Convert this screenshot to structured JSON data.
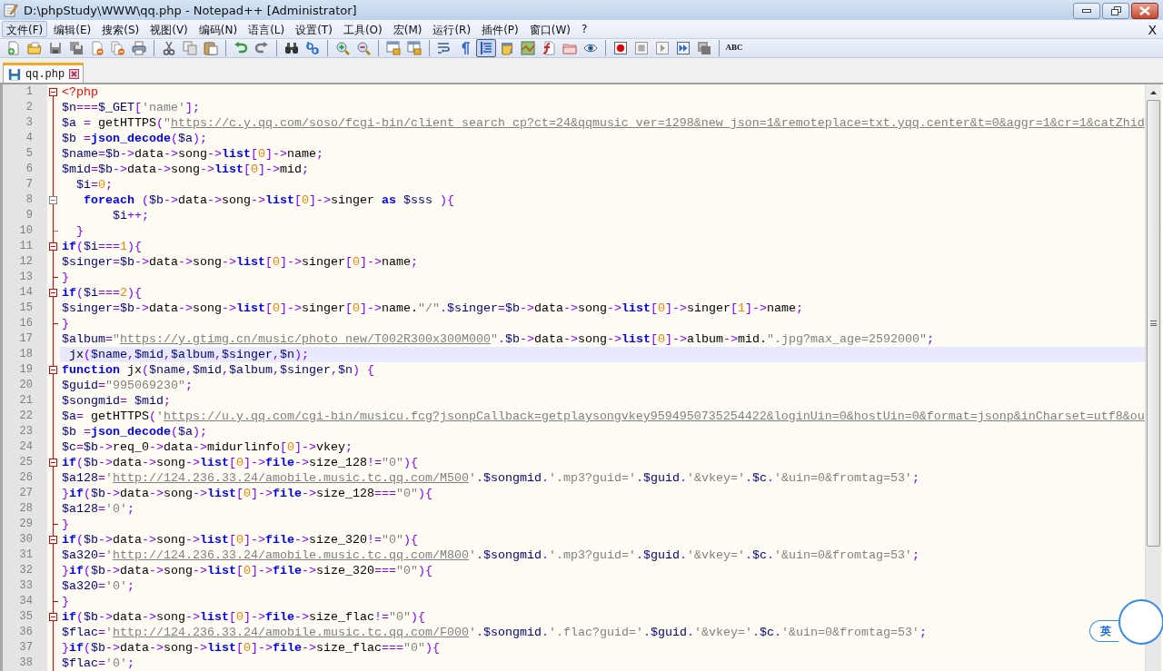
{
  "window": {
    "title": "D:\\phpStudy\\WWW\\qq.php - Notepad++ [Administrator]"
  },
  "menu": {
    "items": [
      {
        "label": "文件(F)",
        "selected": true
      },
      {
        "label": "编辑(E)",
        "selected": false
      },
      {
        "label": "搜索(S)",
        "selected": false
      },
      {
        "label": "视图(V)",
        "selected": false
      },
      {
        "label": "编码(N)",
        "selected": false
      },
      {
        "label": "语言(L)",
        "selected": false
      },
      {
        "label": "设置(T)",
        "selected": false
      },
      {
        "label": "工具(O)",
        "selected": false
      },
      {
        "label": "宏(M)",
        "selected": false
      },
      {
        "label": "运行(R)",
        "selected": false
      },
      {
        "label": "插件(P)",
        "selected": false
      },
      {
        "label": "窗口(W)",
        "selected": false
      },
      {
        "label": "?",
        "selected": false
      }
    ],
    "close_document": "X"
  },
  "toolbar": {
    "groups": [
      [
        {
          "kind": "new",
          "pressed": false
        },
        {
          "kind": "open",
          "pressed": false
        },
        {
          "kind": "save",
          "pressed": false
        },
        {
          "kind": "saveall",
          "pressed": false
        },
        {
          "kind": "close",
          "pressed": false
        },
        {
          "kind": "closeall",
          "pressed": false
        },
        {
          "kind": "print",
          "pressed": false
        }
      ],
      [
        {
          "kind": "cut",
          "pressed": false
        },
        {
          "kind": "copy",
          "pressed": false
        },
        {
          "kind": "paste",
          "pressed": false
        }
      ],
      [
        {
          "kind": "undo",
          "pressed": false
        },
        {
          "kind": "redo",
          "pressed": false
        }
      ],
      [
        {
          "kind": "find",
          "pressed": false
        },
        {
          "kind": "replace",
          "pressed": false
        }
      ],
      [
        {
          "kind": "zoomin",
          "pressed": false
        },
        {
          "kind": "zoomout",
          "pressed": false
        }
      ],
      [
        {
          "kind": "syncv",
          "pressed": false
        },
        {
          "kind": "synch",
          "pressed": false
        }
      ],
      [
        {
          "kind": "wrap",
          "pressed": false
        },
        {
          "kind": "allchars",
          "pressed": false
        },
        {
          "kind": "indent",
          "pressed": true
        },
        {
          "kind": "udl",
          "pressed": false
        },
        {
          "kind": "docmap",
          "pressed": false
        },
        {
          "kind": "funclist",
          "pressed": false
        },
        {
          "kind": "folder",
          "pressed": false
        },
        {
          "kind": "monitor",
          "pressed": false
        }
      ],
      [
        {
          "kind": "record",
          "pressed": false
        },
        {
          "kind": "stop",
          "pressed": false
        },
        {
          "kind": "play",
          "pressed": false
        },
        {
          "kind": "playmulti",
          "pressed": false
        },
        {
          "kind": "savemacro",
          "pressed": false
        }
      ],
      [
        {
          "kind": "spellcheck",
          "pressed": false,
          "label": "ABC"
        }
      ]
    ]
  },
  "tabs": [
    {
      "label": "qq.php",
      "selected": true
    }
  ],
  "editor": {
    "lines": [
      {
        "number": "1",
        "fold": {
          "kind": "start"
        },
        "current": false,
        "tokens": [
          {
            "kind": "tag",
            "text": "<?php"
          }
        ]
      },
      {
        "number": "2",
        "current": false,
        "tokens": [
          {
            "kind": "var",
            "text": "$n"
          },
          {
            "kind": "op",
            "text": "==="
          },
          {
            "kind": "var",
            "text": "$_GET"
          },
          {
            "kind": "op",
            "text": "["
          },
          {
            "kind": "str",
            "text": "'name'"
          },
          {
            "kind": "op",
            "text": "];"
          }
        ]
      },
      {
        "number": "3",
        "current": false,
        "tokens": [
          {
            "kind": "var",
            "text": "$a"
          },
          {
            "kind": "op",
            "text": " ="
          },
          {
            "kind": "plain",
            "text": " getHTTPS"
          },
          {
            "kind": "op",
            "text": "("
          },
          {
            "kind": "str",
            "text": "\""
          },
          {
            "kind": "url",
            "text": "https://c.y.qq.com/soso/fcgi-bin/client_search_cp?ct=24&qqmusic_ver=1298&new_json=1&remoteplace=txt.yqq.center&t=0&aggr=1&cr=1&catZhid"
          }
        ]
      },
      {
        "number": "4",
        "current": false,
        "tokens": [
          {
            "kind": "var",
            "text": "$b"
          },
          {
            "kind": "op",
            "text": " ="
          },
          {
            "kind": "kw",
            "text": "json_decode"
          },
          {
            "kind": "op",
            "text": "("
          },
          {
            "kind": "var",
            "text": "$a"
          },
          {
            "kind": "op",
            "text": ");"
          }
        ]
      },
      {
        "number": "5",
        "current": false,
        "tokens": [
          {
            "kind": "var",
            "text": "$name"
          },
          {
            "kind": "op",
            "text": "="
          },
          {
            "kind": "var",
            "text": "$b"
          },
          {
            "kind": "op",
            "text": "->"
          },
          {
            "kind": "plain",
            "text": "data"
          },
          {
            "kind": "op",
            "text": "->"
          },
          {
            "kind": "plain",
            "text": "song"
          },
          {
            "kind": "op",
            "text": "->"
          },
          {
            "kind": "kw",
            "text": "list"
          },
          {
            "kind": "op",
            "text": "["
          },
          {
            "kind": "num",
            "text": "0"
          },
          {
            "kind": "op",
            "text": "]->"
          },
          {
            "kind": "plain",
            "text": "name"
          },
          {
            "kind": "op",
            "text": ";"
          }
        ]
      },
      {
        "number": "6",
        "current": false,
        "tokens": [
          {
            "kind": "var",
            "text": "$mid"
          },
          {
            "kind": "op",
            "text": "="
          },
          {
            "kind": "var",
            "text": "$b"
          },
          {
            "kind": "op",
            "text": "->"
          },
          {
            "kind": "plain",
            "text": "data"
          },
          {
            "kind": "op",
            "text": "->"
          },
          {
            "kind": "plain",
            "text": "song"
          },
          {
            "kind": "op",
            "text": "->"
          },
          {
            "kind": "kw",
            "text": "list"
          },
          {
            "kind": "op",
            "text": "["
          },
          {
            "kind": "num",
            "text": "0"
          },
          {
            "kind": "op",
            "text": "]->"
          },
          {
            "kind": "plain",
            "text": "mid"
          },
          {
            "kind": "op",
            "text": ";"
          }
        ]
      },
      {
        "number": "7",
        "current": false,
        "tokens": [
          {
            "kind": "var",
            "text": "  $i"
          },
          {
            "kind": "op",
            "text": "="
          },
          {
            "kind": "num",
            "text": "0"
          },
          {
            "kind": "op",
            "text": ";"
          }
        ]
      },
      {
        "number": "8",
        "fold": {
          "kind": "inner-start"
        },
        "current": false,
        "tokens": [
          {
            "kind": "kw",
            "text": "   foreach"
          },
          {
            "kind": "op",
            "text": " ("
          },
          {
            "kind": "var",
            "text": "$b"
          },
          {
            "kind": "op",
            "text": "->"
          },
          {
            "kind": "plain",
            "text": "data"
          },
          {
            "kind": "op",
            "text": "->"
          },
          {
            "kind": "plain",
            "text": "song"
          },
          {
            "kind": "op",
            "text": "->"
          },
          {
            "kind": "kw",
            "text": "list"
          },
          {
            "kind": "op",
            "text": "["
          },
          {
            "kind": "num",
            "text": "0"
          },
          {
            "kind": "op",
            "text": "]->"
          },
          {
            "kind": "plain",
            "text": "singer "
          },
          {
            "kind": "kw",
            "text": "as"
          },
          {
            "kind": "var",
            "text": " $sss"
          },
          {
            "kind": "op",
            "text": " ){"
          }
        ]
      },
      {
        "number": "9",
        "current": false,
        "tokens": [
          {
            "kind": "var",
            "text": "       $i"
          },
          {
            "kind": "op",
            "text": "++;"
          }
        ]
      },
      {
        "number": "10",
        "fold": {
          "kind": "inner-end"
        },
        "current": false,
        "tokens": [
          {
            "kind": "op",
            "text": "  }"
          }
        ]
      },
      {
        "number": "11",
        "fold": {
          "kind": "start"
        },
        "current": false,
        "tokens": [
          {
            "kind": "kw",
            "text": "if"
          },
          {
            "kind": "op",
            "text": "("
          },
          {
            "kind": "var",
            "text": "$i"
          },
          {
            "kind": "op",
            "text": "==="
          },
          {
            "kind": "num",
            "text": "1"
          },
          {
            "kind": "op",
            "text": "){"
          }
        ]
      },
      {
        "number": "12",
        "current": false,
        "tokens": [
          {
            "kind": "var",
            "text": "$singer"
          },
          {
            "kind": "op",
            "text": "="
          },
          {
            "kind": "var",
            "text": "$b"
          },
          {
            "kind": "op",
            "text": "->"
          },
          {
            "kind": "plain",
            "text": "data"
          },
          {
            "kind": "op",
            "text": "->"
          },
          {
            "kind": "plain",
            "text": "song"
          },
          {
            "kind": "op",
            "text": "->"
          },
          {
            "kind": "kw",
            "text": "list"
          },
          {
            "kind": "op",
            "text": "["
          },
          {
            "kind": "num",
            "text": "0"
          },
          {
            "kind": "op",
            "text": "]->"
          },
          {
            "kind": "plain",
            "text": "singer"
          },
          {
            "kind": "op",
            "text": "["
          },
          {
            "kind": "num",
            "text": "0"
          },
          {
            "kind": "op",
            "text": "]->"
          },
          {
            "kind": "plain",
            "text": "name"
          },
          {
            "kind": "op",
            "text": ";"
          }
        ]
      },
      {
        "number": "13",
        "fold": {
          "kind": "end"
        },
        "current": false,
        "tokens": [
          {
            "kind": "op",
            "text": "}"
          }
        ]
      },
      {
        "number": "14",
        "fold": {
          "kind": "start"
        },
        "current": false,
        "tokens": [
          {
            "kind": "kw",
            "text": "if"
          },
          {
            "kind": "op",
            "text": "("
          },
          {
            "kind": "var",
            "text": "$i"
          },
          {
            "kind": "op",
            "text": "==="
          },
          {
            "kind": "num",
            "text": "2"
          },
          {
            "kind": "op",
            "text": "){"
          }
        ]
      },
      {
        "number": "15",
        "current": false,
        "tokens": [
          {
            "kind": "var",
            "text": "$singer"
          },
          {
            "kind": "op",
            "text": "="
          },
          {
            "kind": "var",
            "text": "$b"
          },
          {
            "kind": "op",
            "text": "->"
          },
          {
            "kind": "plain",
            "text": "data"
          },
          {
            "kind": "op",
            "text": "->"
          },
          {
            "kind": "plain",
            "text": "song"
          },
          {
            "kind": "op",
            "text": "->"
          },
          {
            "kind": "kw",
            "text": "list"
          },
          {
            "kind": "op",
            "text": "["
          },
          {
            "kind": "num",
            "text": "0"
          },
          {
            "kind": "op",
            "text": "]->"
          },
          {
            "kind": "plain",
            "text": "singer"
          },
          {
            "kind": "op",
            "text": "["
          },
          {
            "kind": "num",
            "text": "0"
          },
          {
            "kind": "op",
            "text": "]->"
          },
          {
            "kind": "plain",
            "text": "name."
          },
          {
            "kind": "str",
            "text": "\"/\""
          },
          {
            "kind": "op",
            "text": "."
          },
          {
            "kind": "var",
            "text": "$singer"
          },
          {
            "kind": "op",
            "text": "="
          },
          {
            "kind": "var",
            "text": "$b"
          },
          {
            "kind": "op",
            "text": "->"
          },
          {
            "kind": "plain",
            "text": "data"
          },
          {
            "kind": "op",
            "text": "->"
          },
          {
            "kind": "plain",
            "text": "song"
          },
          {
            "kind": "op",
            "text": "->"
          },
          {
            "kind": "kw",
            "text": "list"
          },
          {
            "kind": "op",
            "text": "["
          },
          {
            "kind": "num",
            "text": "0"
          },
          {
            "kind": "op",
            "text": "]->"
          },
          {
            "kind": "plain",
            "text": "singer"
          },
          {
            "kind": "op",
            "text": "["
          },
          {
            "kind": "num",
            "text": "1"
          },
          {
            "kind": "op",
            "text": "]->"
          },
          {
            "kind": "plain",
            "text": "name"
          },
          {
            "kind": "op",
            "text": ";"
          }
        ]
      },
      {
        "number": "16",
        "fold": {
          "kind": "end"
        },
        "current": false,
        "tokens": [
          {
            "kind": "op",
            "text": "}"
          }
        ]
      },
      {
        "number": "17",
        "current": false,
        "tokens": [
          {
            "kind": "var",
            "text": "$album"
          },
          {
            "kind": "op",
            "text": "="
          },
          {
            "kind": "str",
            "text": "\""
          },
          {
            "kind": "url",
            "text": "https://y.gtimg.cn/music/photo_new/T002R300x300M000"
          },
          {
            "kind": "str",
            "text": "\""
          },
          {
            "kind": "op",
            "text": "."
          },
          {
            "kind": "var",
            "text": "$b"
          },
          {
            "kind": "op",
            "text": "->"
          },
          {
            "kind": "plain",
            "text": "data"
          },
          {
            "kind": "op",
            "text": "->"
          },
          {
            "kind": "plain",
            "text": "song"
          },
          {
            "kind": "op",
            "text": "->"
          },
          {
            "kind": "kw",
            "text": "list"
          },
          {
            "kind": "op",
            "text": "["
          },
          {
            "kind": "num",
            "text": "0"
          },
          {
            "kind": "op",
            "text": "]->"
          },
          {
            "kind": "plain",
            "text": "album"
          },
          {
            "kind": "op",
            "text": "->"
          },
          {
            "kind": "plain",
            "text": "mid."
          },
          {
            "kind": "str",
            "text": "\".jpg?max_age=2592000\""
          },
          {
            "kind": "op",
            "text": ";"
          }
        ]
      },
      {
        "number": "18",
        "current": true,
        "tokens": [
          {
            "kind": "plain",
            "text": " jx"
          },
          {
            "kind": "op",
            "text": "("
          },
          {
            "kind": "var",
            "text": "$name"
          },
          {
            "kind": "op",
            "text": ","
          },
          {
            "kind": "var",
            "text": "$mid"
          },
          {
            "kind": "op",
            "text": ","
          },
          {
            "kind": "var",
            "text": "$album"
          },
          {
            "kind": "op",
            "text": ","
          },
          {
            "kind": "var",
            "text": "$singer"
          },
          {
            "kind": "op",
            "text": ","
          },
          {
            "kind": "var",
            "text": "$n"
          },
          {
            "kind": "op",
            "text": ");"
          }
        ]
      },
      {
        "number": "19",
        "fold": {
          "kind": "start"
        },
        "current": false,
        "tokens": [
          {
            "kind": "kw",
            "text": "function"
          },
          {
            "kind": "plain",
            "text": " jx"
          },
          {
            "kind": "op",
            "text": "("
          },
          {
            "kind": "var",
            "text": "$name"
          },
          {
            "kind": "op",
            "text": ","
          },
          {
            "kind": "var",
            "text": "$mid"
          },
          {
            "kind": "op",
            "text": ","
          },
          {
            "kind": "var",
            "text": "$album"
          },
          {
            "kind": "op",
            "text": ","
          },
          {
            "kind": "var",
            "text": "$singer"
          },
          {
            "kind": "op",
            "text": ","
          },
          {
            "kind": "var",
            "text": "$n"
          },
          {
            "kind": "op",
            "text": ") {"
          }
        ]
      },
      {
        "number": "20",
        "current": false,
        "tokens": [
          {
            "kind": "var",
            "text": "$guid"
          },
          {
            "kind": "op",
            "text": "="
          },
          {
            "kind": "str",
            "text": "\"995069230\""
          },
          {
            "kind": "op",
            "text": ";"
          }
        ]
      },
      {
        "number": "21",
        "current": false,
        "tokens": [
          {
            "kind": "var",
            "text": "$songmid"
          },
          {
            "kind": "op",
            "text": "="
          },
          {
            "kind": "var",
            "text": " $mid"
          },
          {
            "kind": "op",
            "text": ";"
          }
        ]
      },
      {
        "number": "22",
        "current": false,
        "tokens": [
          {
            "kind": "var",
            "text": "$a"
          },
          {
            "kind": "op",
            "text": "="
          },
          {
            "kind": "plain",
            "text": " getHTTPS"
          },
          {
            "kind": "op",
            "text": "("
          },
          {
            "kind": "str",
            "text": "'"
          },
          {
            "kind": "url",
            "text": "https://u.y.qq.com/cgi-bin/musicu.fcg?jsonpCallback=getplaysongvkey9594950735254422&loginUin=0&hostUin=0&format=jsonp&inCharset=utf8&ou"
          }
        ]
      },
      {
        "number": "23",
        "current": false,
        "tokens": [
          {
            "kind": "var",
            "text": "$b"
          },
          {
            "kind": "op",
            "text": " ="
          },
          {
            "kind": "kw",
            "text": "json_decode"
          },
          {
            "kind": "op",
            "text": "("
          },
          {
            "kind": "var",
            "text": "$a"
          },
          {
            "kind": "op",
            "text": ");"
          }
        ]
      },
      {
        "number": "24",
        "current": false,
        "tokens": [
          {
            "kind": "var",
            "text": "$c"
          },
          {
            "kind": "op",
            "text": "="
          },
          {
            "kind": "var",
            "text": "$b"
          },
          {
            "kind": "op",
            "text": "->"
          },
          {
            "kind": "plain",
            "text": "req_0"
          },
          {
            "kind": "op",
            "text": "->"
          },
          {
            "kind": "plain",
            "text": "data"
          },
          {
            "kind": "op",
            "text": "->"
          },
          {
            "kind": "plain",
            "text": "midurlinfo"
          },
          {
            "kind": "op",
            "text": "["
          },
          {
            "kind": "num",
            "text": "0"
          },
          {
            "kind": "op",
            "text": "]->"
          },
          {
            "kind": "plain",
            "text": "vkey"
          },
          {
            "kind": "op",
            "text": ";"
          }
        ]
      },
      {
        "number": "25",
        "fold": {
          "kind": "start"
        },
        "current": false,
        "tokens": [
          {
            "kind": "kw",
            "text": "if"
          },
          {
            "kind": "op",
            "text": "("
          },
          {
            "kind": "var",
            "text": "$b"
          },
          {
            "kind": "op",
            "text": "->"
          },
          {
            "kind": "plain",
            "text": "data"
          },
          {
            "kind": "op",
            "text": "->"
          },
          {
            "kind": "plain",
            "text": "song"
          },
          {
            "kind": "op",
            "text": "->"
          },
          {
            "kind": "kw",
            "text": "list"
          },
          {
            "kind": "op",
            "text": "["
          },
          {
            "kind": "num",
            "text": "0"
          },
          {
            "kind": "op",
            "text": "]->"
          },
          {
            "kind": "kw",
            "text": "file"
          },
          {
            "kind": "op",
            "text": "->"
          },
          {
            "kind": "plain",
            "text": "size_128"
          },
          {
            "kind": "op",
            "text": "!="
          },
          {
            "kind": "str",
            "text": "\"0\""
          },
          {
            "kind": "op",
            "text": "){"
          }
        ]
      },
      {
        "number": "26",
        "current": false,
        "tokens": [
          {
            "kind": "var",
            "text": "$a128"
          },
          {
            "kind": "op",
            "text": "="
          },
          {
            "kind": "str",
            "text": "'"
          },
          {
            "kind": "url",
            "text": "http://124.236.33.24/amobile.music.tc.qq.com/M500"
          },
          {
            "kind": "str",
            "text": "'"
          },
          {
            "kind": "op",
            "text": "."
          },
          {
            "kind": "var",
            "text": "$songmid"
          },
          {
            "kind": "op",
            "text": "."
          },
          {
            "kind": "str",
            "text": "'.mp3?guid='"
          },
          {
            "kind": "op",
            "text": "."
          },
          {
            "kind": "var",
            "text": "$guid"
          },
          {
            "kind": "op",
            "text": "."
          },
          {
            "kind": "str",
            "text": "'&vkey='"
          },
          {
            "kind": "op",
            "text": "."
          },
          {
            "kind": "var",
            "text": "$c"
          },
          {
            "kind": "op",
            "text": "."
          },
          {
            "kind": "str",
            "text": "'&uin=0&fromtag=53'"
          },
          {
            "kind": "op",
            "text": ";"
          }
        ]
      },
      {
        "number": "27",
        "current": false,
        "tokens": [
          {
            "kind": "op",
            "text": "}"
          },
          {
            "kind": "kw",
            "text": "if"
          },
          {
            "kind": "op",
            "text": "("
          },
          {
            "kind": "var",
            "text": "$b"
          },
          {
            "kind": "op",
            "text": "->"
          },
          {
            "kind": "plain",
            "text": "data"
          },
          {
            "kind": "op",
            "text": "->"
          },
          {
            "kind": "plain",
            "text": "song"
          },
          {
            "kind": "op",
            "text": "->"
          },
          {
            "kind": "kw",
            "text": "list"
          },
          {
            "kind": "op",
            "text": "["
          },
          {
            "kind": "num",
            "text": "0"
          },
          {
            "kind": "op",
            "text": "]->"
          },
          {
            "kind": "kw",
            "text": "file"
          },
          {
            "kind": "op",
            "text": "->"
          },
          {
            "kind": "plain",
            "text": "size_128"
          },
          {
            "kind": "op",
            "text": "==="
          },
          {
            "kind": "str",
            "text": "\"0\""
          },
          {
            "kind": "op",
            "text": "){"
          }
        ]
      },
      {
        "number": "28",
        "current": false,
        "tokens": [
          {
            "kind": "var",
            "text": "$a128"
          },
          {
            "kind": "op",
            "text": "="
          },
          {
            "kind": "str",
            "text": "'0'"
          },
          {
            "kind": "op",
            "text": ";"
          }
        ]
      },
      {
        "number": "29",
        "fold": {
          "kind": "end"
        },
        "current": false,
        "tokens": [
          {
            "kind": "op",
            "text": "}"
          }
        ]
      },
      {
        "number": "30",
        "fold": {
          "kind": "start"
        },
        "current": false,
        "tokens": [
          {
            "kind": "kw",
            "text": "if"
          },
          {
            "kind": "op",
            "text": "("
          },
          {
            "kind": "var",
            "text": "$b"
          },
          {
            "kind": "op",
            "text": "->"
          },
          {
            "kind": "plain",
            "text": "data"
          },
          {
            "kind": "op",
            "text": "->"
          },
          {
            "kind": "plain",
            "text": "song"
          },
          {
            "kind": "op",
            "text": "->"
          },
          {
            "kind": "kw",
            "text": "list"
          },
          {
            "kind": "op",
            "text": "["
          },
          {
            "kind": "num",
            "text": "0"
          },
          {
            "kind": "op",
            "text": "]->"
          },
          {
            "kind": "kw",
            "text": "file"
          },
          {
            "kind": "op",
            "text": "->"
          },
          {
            "kind": "plain",
            "text": "size_320"
          },
          {
            "kind": "op",
            "text": "!="
          },
          {
            "kind": "str",
            "text": "\"0\""
          },
          {
            "kind": "op",
            "text": "){"
          }
        ]
      },
      {
        "number": "31",
        "current": false,
        "tokens": [
          {
            "kind": "var",
            "text": "$a320"
          },
          {
            "kind": "op",
            "text": "="
          },
          {
            "kind": "str",
            "text": "'"
          },
          {
            "kind": "url",
            "text": "http://124.236.33.24/amobile.music.tc.qq.com/M800"
          },
          {
            "kind": "str",
            "text": "'"
          },
          {
            "kind": "op",
            "text": "."
          },
          {
            "kind": "var",
            "text": "$songmid"
          },
          {
            "kind": "op",
            "text": "."
          },
          {
            "kind": "str",
            "text": "'.mp3?guid='"
          },
          {
            "kind": "op",
            "text": "."
          },
          {
            "kind": "var",
            "text": "$guid"
          },
          {
            "kind": "op",
            "text": "."
          },
          {
            "kind": "str",
            "text": "'&vkey='"
          },
          {
            "kind": "op",
            "text": "."
          },
          {
            "kind": "var",
            "text": "$c"
          },
          {
            "kind": "op",
            "text": "."
          },
          {
            "kind": "str",
            "text": "'&uin=0&fromtag=53'"
          },
          {
            "kind": "op",
            "text": ";"
          }
        ]
      },
      {
        "number": "32",
        "current": false,
        "tokens": [
          {
            "kind": "op",
            "text": "}"
          },
          {
            "kind": "kw",
            "text": "if"
          },
          {
            "kind": "op",
            "text": "("
          },
          {
            "kind": "var",
            "text": "$b"
          },
          {
            "kind": "op",
            "text": "->"
          },
          {
            "kind": "plain",
            "text": "data"
          },
          {
            "kind": "op",
            "text": "->"
          },
          {
            "kind": "plain",
            "text": "song"
          },
          {
            "kind": "op",
            "text": "->"
          },
          {
            "kind": "kw",
            "text": "list"
          },
          {
            "kind": "op",
            "text": "["
          },
          {
            "kind": "num",
            "text": "0"
          },
          {
            "kind": "op",
            "text": "]->"
          },
          {
            "kind": "kw",
            "text": "file"
          },
          {
            "kind": "op",
            "text": "->"
          },
          {
            "kind": "plain",
            "text": "size_320"
          },
          {
            "kind": "op",
            "text": "==="
          },
          {
            "kind": "str",
            "text": "\"0\""
          },
          {
            "kind": "op",
            "text": "){"
          }
        ]
      },
      {
        "number": "33",
        "current": false,
        "tokens": [
          {
            "kind": "var",
            "text": "$a320"
          },
          {
            "kind": "op",
            "text": "="
          },
          {
            "kind": "str",
            "text": "'0'"
          },
          {
            "kind": "op",
            "text": ";"
          }
        ]
      },
      {
        "number": "34",
        "fold": {
          "kind": "end"
        },
        "current": false,
        "tokens": [
          {
            "kind": "op",
            "text": "}"
          }
        ]
      },
      {
        "number": "35",
        "fold": {
          "kind": "start"
        },
        "current": false,
        "tokens": [
          {
            "kind": "kw",
            "text": "if"
          },
          {
            "kind": "op",
            "text": "("
          },
          {
            "kind": "var",
            "text": "$b"
          },
          {
            "kind": "op",
            "text": "->"
          },
          {
            "kind": "plain",
            "text": "data"
          },
          {
            "kind": "op",
            "text": "->"
          },
          {
            "kind": "plain",
            "text": "song"
          },
          {
            "kind": "op",
            "text": "->"
          },
          {
            "kind": "kw",
            "text": "list"
          },
          {
            "kind": "op",
            "text": "["
          },
          {
            "kind": "num",
            "text": "0"
          },
          {
            "kind": "op",
            "text": "]->"
          },
          {
            "kind": "kw",
            "text": "file"
          },
          {
            "kind": "op",
            "text": "->"
          },
          {
            "kind": "plain",
            "text": "size_flac"
          },
          {
            "kind": "op",
            "text": "!="
          },
          {
            "kind": "str",
            "text": "\"0\""
          },
          {
            "kind": "op",
            "text": "){"
          }
        ]
      },
      {
        "number": "36",
        "current": false,
        "tokens": [
          {
            "kind": "var",
            "text": "$flac"
          },
          {
            "kind": "op",
            "text": "="
          },
          {
            "kind": "str",
            "text": "'"
          },
          {
            "kind": "url",
            "text": "http://124.236.33.24/amobile.music.tc.qq.com/F000"
          },
          {
            "kind": "str",
            "text": "'"
          },
          {
            "kind": "op",
            "text": "."
          },
          {
            "kind": "var",
            "text": "$songmid"
          },
          {
            "kind": "op",
            "text": "."
          },
          {
            "kind": "str",
            "text": "'.flac?guid='"
          },
          {
            "kind": "op",
            "text": "."
          },
          {
            "kind": "var",
            "text": "$guid"
          },
          {
            "kind": "op",
            "text": "."
          },
          {
            "kind": "str",
            "text": "'&vkey='"
          },
          {
            "kind": "op",
            "text": "."
          },
          {
            "kind": "var",
            "text": "$c"
          },
          {
            "kind": "op",
            "text": "."
          },
          {
            "kind": "str",
            "text": "'&uin=0&fromtag=53'"
          },
          {
            "kind": "op",
            "text": ";"
          }
        ]
      },
      {
        "number": "37",
        "current": false,
        "tokens": [
          {
            "kind": "op",
            "text": "}"
          },
          {
            "kind": "kw",
            "text": "if"
          },
          {
            "kind": "op",
            "text": "("
          },
          {
            "kind": "var",
            "text": "$b"
          },
          {
            "kind": "op",
            "text": "->"
          },
          {
            "kind": "plain",
            "text": "data"
          },
          {
            "kind": "op",
            "text": "->"
          },
          {
            "kind": "plain",
            "text": "song"
          },
          {
            "kind": "op",
            "text": "->"
          },
          {
            "kind": "kw",
            "text": "list"
          },
          {
            "kind": "op",
            "text": "["
          },
          {
            "kind": "num",
            "text": "0"
          },
          {
            "kind": "op",
            "text": "]->"
          },
          {
            "kind": "kw",
            "text": "file"
          },
          {
            "kind": "op",
            "text": "->"
          },
          {
            "kind": "plain",
            "text": "size_flac"
          },
          {
            "kind": "op",
            "text": "==="
          },
          {
            "kind": "str",
            "text": "\"0\""
          },
          {
            "kind": "op",
            "text": "){"
          }
        ]
      },
      {
        "number": "38",
        "current": false,
        "tokens": [
          {
            "kind": "var",
            "text": "$flac"
          },
          {
            "kind": "op",
            "text": "="
          },
          {
            "kind": "str",
            "text": "'0'"
          },
          {
            "kind": "op",
            "text": ";"
          }
        ]
      }
    ]
  },
  "ime": {
    "label": "英"
  }
}
